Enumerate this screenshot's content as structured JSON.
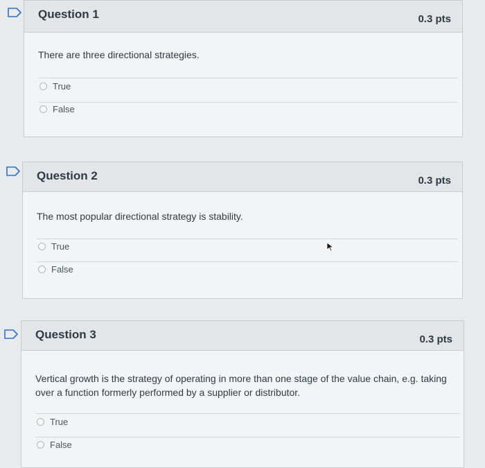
{
  "questions": [
    {
      "title": "Question 1",
      "points": "0.3 pts",
      "text": "There are three directional strategies.",
      "answers": [
        "True",
        "False"
      ]
    },
    {
      "title": "Question 2",
      "points": "0.3 pts",
      "text": "The most popular directional strategy is stability.",
      "answers": [
        "True",
        "False"
      ]
    },
    {
      "title": "Question 3",
      "points": "0.3 pts",
      "text": "Vertical growth is the strategy of operating in more than one stage of the value chain, e.g. taking over a function formerly performed by a supplier or distributor.",
      "answers": [
        "True",
        "False"
      ]
    }
  ],
  "colors": {
    "flag": "#2a6fd6",
    "header_bg": "#e3e5e8",
    "card_bg": "#f3f4f5",
    "border": "#c8ccd0",
    "text": "#2d3b45"
  },
  "icons": {
    "flag": "flag-icon",
    "radio": "radio-icon",
    "cursor": "mouse-cursor-icon"
  }
}
